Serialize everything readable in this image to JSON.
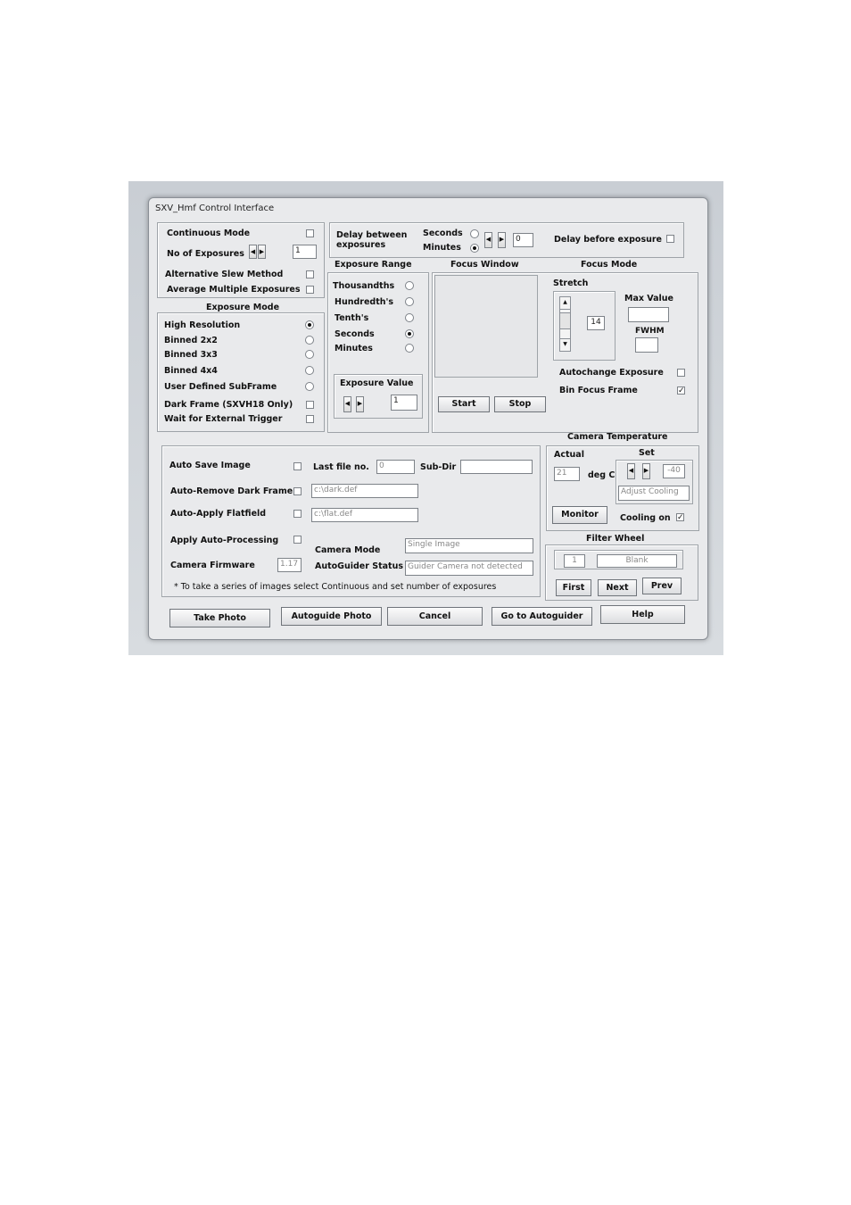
{
  "window": {
    "title": "SXV_Hmf Control Interface"
  },
  "top_left": {
    "continuous_mode": "Continuous Mode",
    "no_of_exposures": "No of Exposures",
    "no_of_exposures_value": "1",
    "alt_slew": "Alternative Slew Method",
    "avg_multi": "Average Multiple Exposures"
  },
  "exposure_mode": {
    "title": "Exposure Mode",
    "items": [
      "High Resolution",
      "Binned 2x2",
      "Binned 3x3",
      "Binned 4x4",
      "User Defined SubFrame"
    ],
    "selected": "High Resolution",
    "dark_frame": "Dark Frame (SXVH18 Only)",
    "wait_trigger": "Wait for External Trigger"
  },
  "delay": {
    "label": "Delay between exposures",
    "seconds": "Seconds",
    "minutes": "Minutes",
    "selected": "Minutes",
    "value": "0",
    "delay_before": "Delay before exposure"
  },
  "exposure_range": {
    "title": "Exposure Range",
    "items": [
      "Thousandths",
      "Hundredth's",
      "Tenth's",
      "Seconds",
      "Minutes"
    ],
    "selected": "Seconds",
    "exposure_value_label": "Exposure Value",
    "exposure_value": "1"
  },
  "focus_window": {
    "title": "Focus Window",
    "start": "Start",
    "stop": "Stop"
  },
  "focus_mode": {
    "title": "Focus Mode",
    "stretch": "Stretch",
    "stretch_value": "14",
    "max_value": "Max Value",
    "fwhm": "FWHM",
    "autochange": "Autochange Exposure",
    "bin_focus": "Bin Focus Frame",
    "bin_focus_checked": true
  },
  "save": {
    "auto_save": "Auto Save Image",
    "last_file_no": "Last file no.",
    "last_file_value": "0",
    "sub_dir": "Sub-Dir",
    "auto_remove_dark": "Auto-Remove Dark Frame",
    "dark_file": "c:\\dark.def",
    "auto_apply_flat": "Auto-Apply Flatfield",
    "flat_file": "c:\\flat.def",
    "apply_auto_processing": "Apply Auto-Processing",
    "camera_mode": "Camera Mode",
    "camera_mode_value": "Single Image",
    "camera_firmware": "Camera Firmware",
    "firmware_value": "1.17",
    "autoguider_status": "AutoGuider Status",
    "autoguider_value": "Guider Camera not detected",
    "note": "* To take a series of images select Continuous and set number of exposures"
  },
  "camera_temp": {
    "title": "Camera Temperature",
    "actual": "Actual",
    "actual_value": "21",
    "deg_c": "deg C",
    "set": "Set",
    "set_value": "-40",
    "adjust_cooling": "Adjust Cooling",
    "monitor": "Monitor",
    "cooling_on": "Cooling on",
    "cooling_checked": true
  },
  "filter_wheel": {
    "title": "Filter Wheel",
    "position": "1",
    "name": "Blank",
    "first": "First",
    "next": "Next",
    "prev": "Prev"
  },
  "bottom_buttons": {
    "take_photo": "Take Photo",
    "autoguide_photo": "Autoguide Photo",
    "cancel": "Cancel",
    "go_autoguider": "Go to Autoguider",
    "help": "Help"
  }
}
